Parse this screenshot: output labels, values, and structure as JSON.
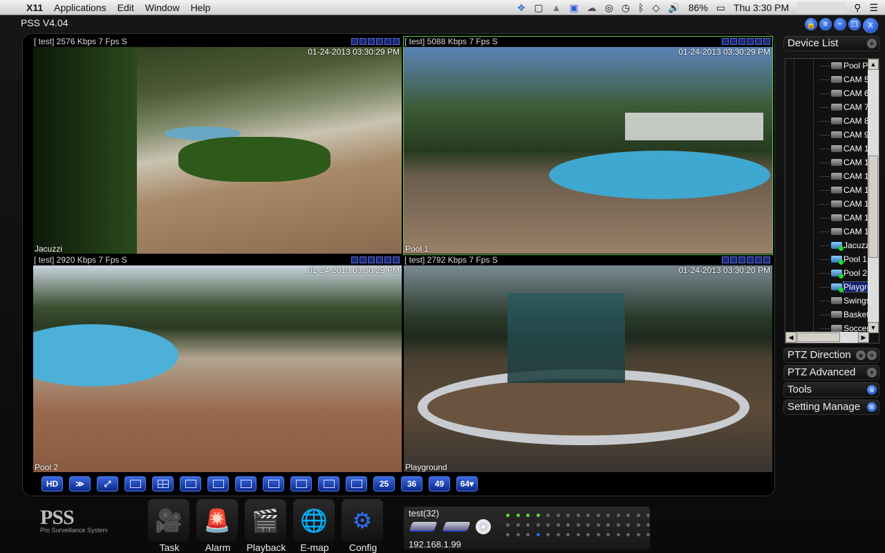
{
  "menubar": {
    "apple": "",
    "app": "X11",
    "items": [
      "Applications",
      "Edit",
      "Window",
      "Help"
    ],
    "battery": "86%",
    "clock": "Thu 3:30 PM",
    "status_icons": [
      "dropbox-icon",
      "evernote-icon",
      "drive-icon",
      "teamviewer-icon",
      "cloud-icon",
      "opera-icon",
      "time-machine-icon",
      "bluetooth-icon",
      "wifi-icon",
      "volume-icon",
      "battery-icon",
      "search-icon",
      "list-icon"
    ]
  },
  "window": {
    "title": "PSS  V4.04",
    "buttons": [
      "lock",
      "menu",
      "minimize",
      "restore",
      "close"
    ],
    "close_label": "X"
  },
  "quads": [
    {
      "header": "[ test] 2576 Kbps 7 Fps S",
      "timestamp": "01-24-2013 03:30:29 PM",
      "caption": "Jacuzzi",
      "selected": false
    },
    {
      "header": "[ test] 5088 Kbps 7 Fps S",
      "timestamp": "01-24-2013 03:30:29 PM",
      "caption": "Pool 1",
      "selected": true
    },
    {
      "header": "[ test] 2920 Kbps 7 Fps S",
      "timestamp": "01-24-2013 03:30:29 PM",
      "caption": "Pool 2",
      "selected": false
    },
    {
      "header": "[ test] 2792 Kbps 7 Fps S",
      "timestamp": "01-24-2013 03:30:20 PM",
      "caption": "Playground",
      "selected": false
    }
  ],
  "toolbar": {
    "buttons": [
      "HD",
      "",
      "",
      "",
      "",
      "",
      "",
      "",
      "",
      "",
      "",
      "",
      "25",
      "36",
      "49",
      "64▾"
    ]
  },
  "panel": {
    "device_list": "Device List",
    "ptz_direction": "PTZ Direction",
    "ptz_advanced": "PTZ Advanced",
    "tools": "Tools",
    "setting_manage": "Setting Manage",
    "tree": [
      {
        "label": "Pool P",
        "online": false
      },
      {
        "label": "CAM 5",
        "online": false
      },
      {
        "label": "CAM 6",
        "online": false
      },
      {
        "label": "CAM 7",
        "online": false
      },
      {
        "label": "CAM 8",
        "online": false
      },
      {
        "label": "CAM 9",
        "online": false
      },
      {
        "label": "CAM 1",
        "online": false
      },
      {
        "label": "CAM 1",
        "online": false
      },
      {
        "label": "CAM 1",
        "online": false
      },
      {
        "label": "CAM 1",
        "online": false
      },
      {
        "label": "CAM 1",
        "online": false
      },
      {
        "label": "CAM 1",
        "online": false
      },
      {
        "label": "CAM 1",
        "online": false
      },
      {
        "label": "Jacuzzi",
        "online": true
      },
      {
        "label": "Pool 1",
        "online": true
      },
      {
        "label": "Pool 2",
        "online": true
      },
      {
        "label": "Playground",
        "online": true,
        "selected": true
      },
      {
        "label": "Swings",
        "online": false
      },
      {
        "label": "Basketball",
        "online": false
      },
      {
        "label": "Soccer",
        "online": false
      }
    ]
  },
  "logo": {
    "big": "PSS",
    "small": "Pro Surveillance System"
  },
  "dock": [
    {
      "label": "Task",
      "icon": "🎥"
    },
    {
      "label": "Alarm",
      "icon": "🚨"
    },
    {
      "label": "Playback",
      "icon": "🎬"
    },
    {
      "label": "E-map",
      "icon": "🌐"
    },
    {
      "label": "Config",
      "icon": "⚙"
    }
  ],
  "device_status": {
    "name": "test(32)",
    "ip": "192.168.1.99",
    "leds_green": [
      0,
      1,
      2,
      3
    ],
    "leds_blue_row3": [
      3
    ]
  }
}
